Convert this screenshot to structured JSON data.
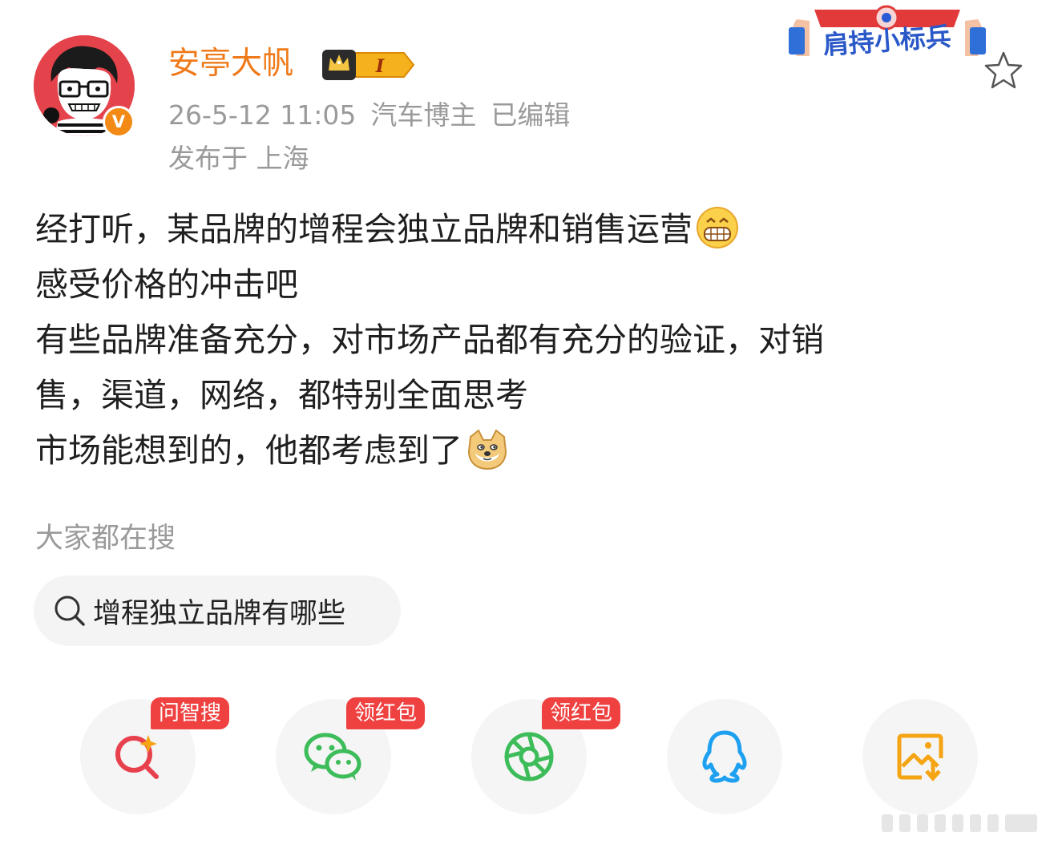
{
  "user": {
    "name": "安亭大帆",
    "level_badge": "I",
    "verified_badge": "V"
  },
  "meta": {
    "time": "26-5-12 11:05",
    "role": "汽车博主",
    "edited": "已编辑",
    "location": "发布于 上海"
  },
  "banner": {
    "text": "肩持小标兵"
  },
  "post": {
    "lines": [
      "经打听，某品牌的增程会独立品牌和销售运营",
      "感受价格的冲击吧",
      "有些品牌准备充分，对市场产品都有充分的验证，对销",
      "售，渠道，网络，都特别全面思考",
      "市场能想到的，他都考虑到了"
    ],
    "emojis": [
      "grin-emoji",
      "doge-emoji"
    ]
  },
  "trending": {
    "title": "大家都在搜",
    "query": "增程独立品牌有哪些"
  },
  "share": [
    {
      "name": "问智搜",
      "badge": "问智搜",
      "icon": "ai-search-icon",
      "color": "#e8414e"
    },
    {
      "name": "wechat",
      "badge": "领红包",
      "icon": "wechat-icon",
      "color": "#3dbc5a"
    },
    {
      "name": "moments",
      "badge": "领红包",
      "icon": "moments-icon",
      "color": "#3dbc5a"
    },
    {
      "name": "qq",
      "badge": "",
      "icon": "qq-icon",
      "color": "#1ea0f0"
    },
    {
      "name": "save-image",
      "badge": "",
      "icon": "save-image-icon",
      "color": "#f5a414"
    }
  ],
  "colors": {
    "username": "#ef7a1a",
    "meta": "#9a9a9a",
    "badge_red": "#f04141",
    "vip_orange": "#f28a15"
  }
}
